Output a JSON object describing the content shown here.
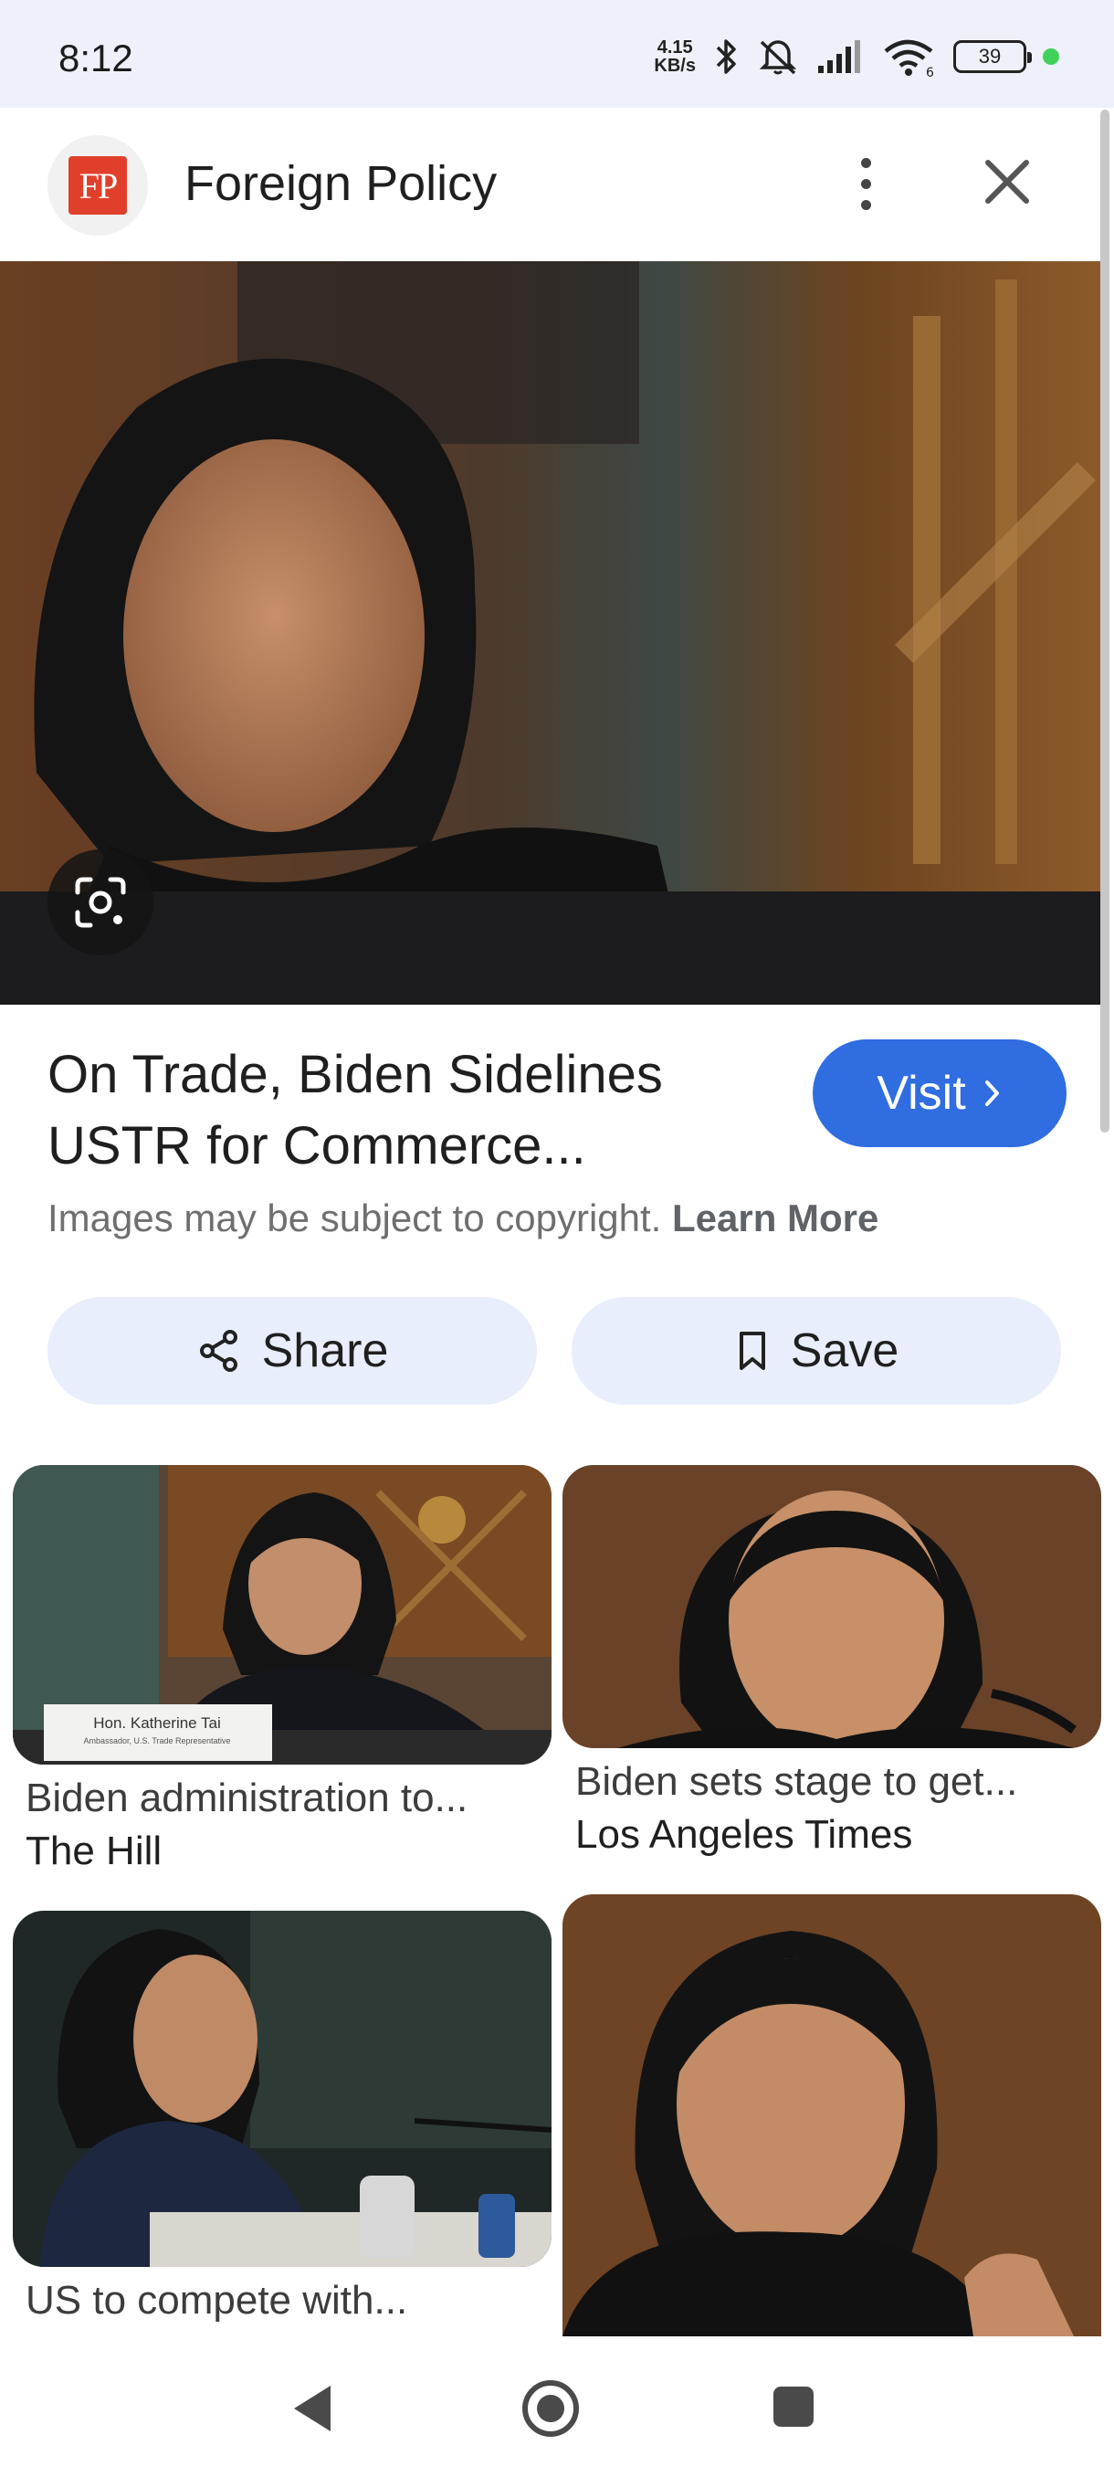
{
  "status_bar": {
    "time": "8:12",
    "net_speed_value": "4.15",
    "net_speed_unit": "KB/s",
    "wifi_label": "6",
    "battery": "39"
  },
  "header": {
    "logo_text": "FP",
    "site_name": "Foreign Policy"
  },
  "result": {
    "title_line1": "On Trade, Biden Sidelines",
    "title_line2": "USTR for Commerce...",
    "visit_label": "Visit",
    "copyright_text": "Images may be subject to copyright.",
    "learn_more": "Learn More",
    "share_label": "Share",
    "save_label": "Save"
  },
  "related": [
    {
      "title": "Biden administration to...",
      "source": "The Hill",
      "nameplate_line1": "Hon. Katherine Tai",
      "nameplate_line2": "Ambassador, U.S. Trade Representative"
    },
    {
      "title": "Biden sets stage to get...",
      "source": "Los Angeles Times"
    },
    {
      "title": "US to compete with...",
      "source": ""
    },
    {
      "title": "",
      "source": ""
    }
  ],
  "colors": {
    "accent": "#2f6de1",
    "chip_bg": "#e8eefb",
    "status_bg": "#eef1f9",
    "logo_red": "#e0402b"
  }
}
